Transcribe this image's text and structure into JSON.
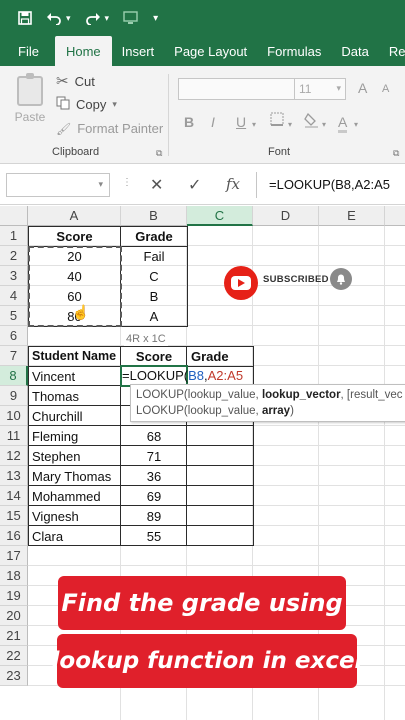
{
  "quick_access": {
    "icons": [
      "save-icon",
      "undo-icon",
      "undo-dropdown-icon",
      "redo-icon",
      "redo-dropdown-icon",
      "screen-icon",
      "customize-icon"
    ]
  },
  "ribbon_tabs": [
    "File",
    "Home",
    "Insert",
    "Page Layout",
    "Formulas",
    "Data",
    "Re"
  ],
  "active_tab": "Home",
  "clipboard": {
    "paste": "Paste",
    "cut": "Cut",
    "copy": "Copy",
    "format_painter": "Format Painter",
    "group_label": "Clipboard"
  },
  "font_group": {
    "font_size": "11",
    "group_label": "Font",
    "bold": "B",
    "italic": "I",
    "underline": "U",
    "grow": "A",
    "shrink": "A"
  },
  "formula_bar": {
    "cancel": "✕",
    "enter": "✓",
    "fx": "fx",
    "formula": "=LOOKUP(B8,A2:A5"
  },
  "columns": [
    "A",
    "B",
    "C",
    "D",
    "E"
  ],
  "rows": [
    "1",
    "2",
    "3",
    "4",
    "5",
    "6",
    "7",
    "8",
    "9",
    "10",
    "11",
    "12",
    "13",
    "14",
    "15",
    "16",
    "17",
    "18",
    "19",
    "20",
    "21",
    "22",
    "23"
  ],
  "grade_table": {
    "headers": [
      "Score",
      "Grade"
    ],
    "rows": [
      [
        "20",
        "Fail"
      ],
      [
        "40",
        "C"
      ],
      [
        "60",
        "B"
      ],
      [
        "80",
        "A"
      ]
    ]
  },
  "student_table": {
    "headers": [
      "Student Name",
      "Score",
      "Grade"
    ],
    "rows": [
      [
        "Vincent",
        ""
      ],
      [
        "Thomas",
        ""
      ],
      [
        "Churchill",
        ""
      ],
      [
        "Fleming",
        "68"
      ],
      [
        "Stephen",
        "71"
      ],
      [
        "Mary Thomas",
        "36"
      ],
      [
        "Mohammed",
        "69"
      ],
      [
        "Vignesh",
        "89"
      ],
      [
        "Clara",
        "55"
      ]
    ]
  },
  "editing": {
    "prefix": "=LOOKUP(",
    "ref1": "B8",
    "sep": ",",
    "ref2": "A2:A5",
    "selection_size": "4R x 1C"
  },
  "tooltip": {
    "line1_a": "LOOKUP(lookup_value, ",
    "line1_b": "lookup_vector",
    "line1_c": ", [result_vec",
    "line2_a": "LOOKUP(lookup_value, ",
    "line2_b": "array",
    "line2_c": ")"
  },
  "overlay": {
    "subscribed": "SUBSCRIBED",
    "banner1": "Find the grade using",
    "banner2": "lookup function in excel"
  },
  "colors": {
    "excel_green": "#217346",
    "banner_red": "#e0202b",
    "youtube_red": "#e62117"
  }
}
